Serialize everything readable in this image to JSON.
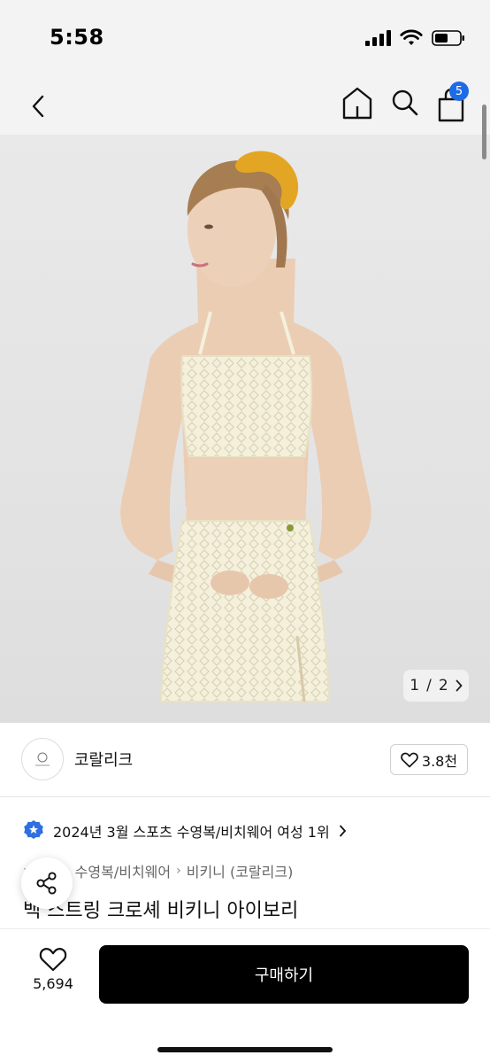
{
  "status_bar": {
    "time": "5:58"
  },
  "nav": {
    "cart_count": "5"
  },
  "gallery": {
    "current": "1",
    "separator": "/",
    "total": "2"
  },
  "brand": {
    "name": "코랄리크",
    "likes": "3.8천"
  },
  "award": {
    "text": "2024년 3월 스포츠 수영복/비치웨어 여성 1위"
  },
  "breadcrumb": [
    "레저",
    "수영복/비치웨어",
    "비키니 (코랄리크)"
  ],
  "product": {
    "title": "백 스트링 크로셰 비키니 아이보리"
  },
  "bottom": {
    "wish_count": "5,694",
    "buy_label": "구매하기"
  },
  "icons": {
    "back": "chevron-left-icon",
    "home": "home-icon",
    "search": "search-icon",
    "cart": "shopping-bag-icon",
    "heart": "heart-icon",
    "award": "star-badge-icon",
    "share": "share-icon"
  },
  "colors": {
    "accent": "#1e6be6",
    "buy_button": "#000000",
    "award_badge": "#2f6fe0"
  }
}
